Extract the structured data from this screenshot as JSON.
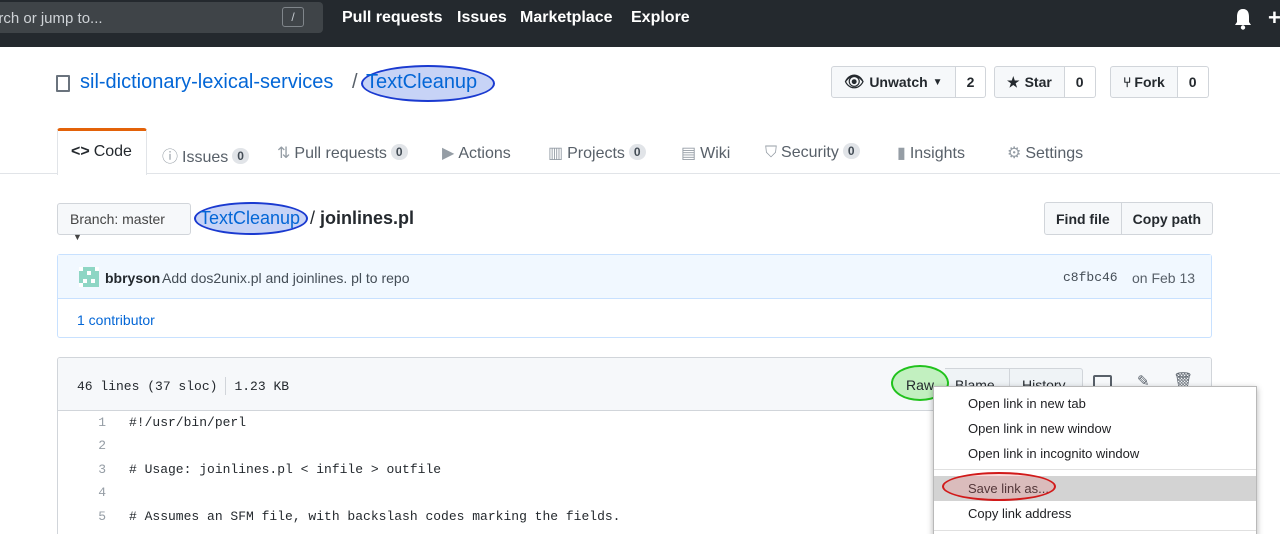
{
  "header": {
    "search_placeholder": "arch or jump to...",
    "slash_key": "/",
    "nav": [
      "Pull requests",
      "Issues",
      "Marketplace",
      "Explore"
    ],
    "plus": "+"
  },
  "repo": {
    "owner": "sil-dictionary-lexical-services",
    "separator": "/",
    "name": "TextCleanup",
    "unwatch_label": "Unwatch",
    "unwatch_count": "2",
    "star_label": "Star",
    "star_count": "0",
    "fork_label": "Fork",
    "fork_count": "0"
  },
  "tabs": [
    {
      "label": "Code",
      "icon": "<>"
    },
    {
      "label": "Issues",
      "count": "0",
      "icon": "ⓘ"
    },
    {
      "label": "Pull requests",
      "count": "0",
      "icon": "⇅"
    },
    {
      "label": "Actions",
      "icon": "▶"
    },
    {
      "label": "Projects",
      "count": "0",
      "icon": "▥"
    },
    {
      "label": "Wiki",
      "icon": "▤"
    },
    {
      "label": "Security",
      "count": "0",
      "icon": "⛉"
    },
    {
      "label": "Insights",
      "icon": "▮"
    },
    {
      "label": "Settings",
      "icon": "⚙"
    }
  ],
  "branch": {
    "label": "Branch: master",
    "crumb_repo": "TextCleanup",
    "crumb_sep": "/ ",
    "file": "joinlines.pl",
    "find_file": "Find file",
    "copy_path": "Copy path"
  },
  "commit": {
    "author": "bbryson",
    "message": "Add dos2unix.pl and joinlines. pl to repo",
    "sha": "c8fbc46",
    "date": "on Feb 13",
    "contributors": "1 contributor"
  },
  "file": {
    "lines_info": "46 lines (37 sloc)",
    "size": "1.23 KB",
    "raw": "Raw",
    "blame": "Blame",
    "history": "History",
    "code": [
      {
        "n": "1",
        "text": "#!/usr/bin/perl"
      },
      {
        "n": "2",
        "text": ""
      },
      {
        "n": "3",
        "text": "# Usage: joinlines.pl < infile > outfile"
      },
      {
        "n": "4",
        "text": ""
      },
      {
        "n": "5",
        "text": "# Assumes an SFM file, with backslash codes marking the fields."
      }
    ]
  },
  "context_menu": {
    "items": [
      "Open link in new tab",
      "Open link in new window",
      "Open link in incognito window",
      "Save link as...",
      "Copy link address"
    ]
  },
  "colors": {
    "annotation_blue": "#1a3ad0",
    "annotation_green": "#21c21d",
    "annotation_red": "#d11a1a",
    "link": "#0366d6"
  }
}
